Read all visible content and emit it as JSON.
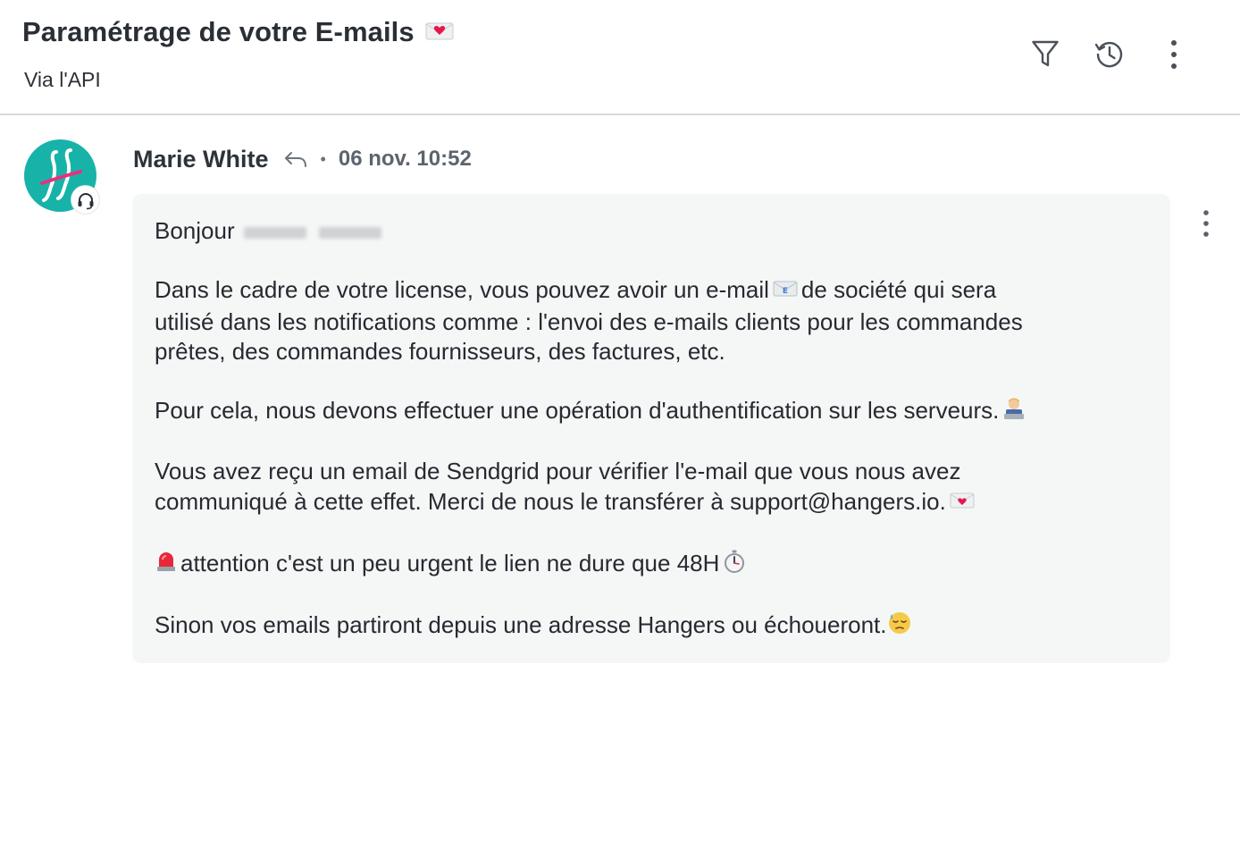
{
  "header": {
    "title": "Paramétrage de votre E-mails",
    "subtitle": "Via l'API",
    "tools": [
      {
        "icon": "filter-icon",
        "label": "Filtrer"
      },
      {
        "icon": "history-icon",
        "label": "Historique"
      },
      {
        "icon": "more-vertical-icon",
        "label": "Plus"
      }
    ]
  },
  "message": {
    "author": "Marie White",
    "time": "06 nov. 10:52",
    "greeting": "Bonjour",
    "paragraph1_line1_a": "Dans le cadre de votre license, vous pouvez avoir un e-mail",
    "paragraph1_line1_b": "de société qui sera",
    "paragraph1_line2": "utilisé dans les notifications comme : l'envoi des e-mails clients pour les commandes",
    "paragraph1_line3": "prêtes, des commandes fournisseurs, des factures, etc.",
    "paragraph2": "Pour cela, nous devons effectuer une opération d'authentification sur les serveurs.",
    "paragraph3_line1": "Vous avez reçu un email de Sendgrid pour vérifier l'e-mail que vous nous avez",
    "paragraph3_line2": "communiqué à cette effet. Merci de nous le transférer à support@hangers.io.",
    "paragraph4": "attention c'est un peu urgent le lien ne dure que 48H",
    "paragraph5": "Sinon vos emails partiront depuis une adresse Hangers ou échoueront."
  },
  "colors": {
    "avatar_bg": "#17b3a9",
    "avatar_accent": "#e8307c",
    "bubble_bg": "#f5f7f7",
    "divider": "#d7d9dc"
  }
}
